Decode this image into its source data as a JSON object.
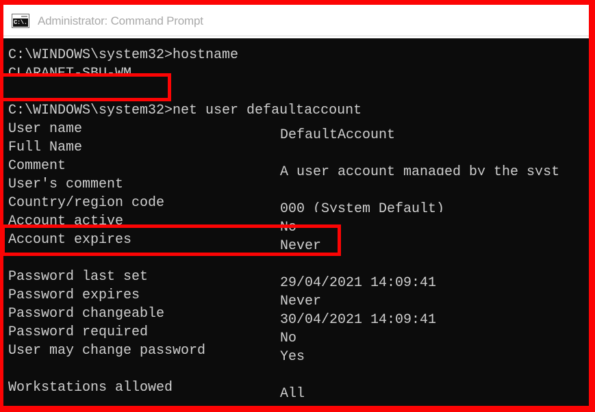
{
  "window": {
    "title": "Administrator: Command Prompt",
    "icon": "command-prompt-icon",
    "icon_glyph": "C:\\.",
    "background_sliver_text": "· ···  ··· ··   ··  ·  ·   ·· ·  ··  ·"
  },
  "colors": {
    "annotation_red": "#fc0404",
    "console_background": "#0c0c0c",
    "console_text": "#cfcfcf",
    "titlebar_background": "#ffffff",
    "titlebar_text": "#a9a9a9"
  },
  "console": {
    "prompt_path": "C:\\WINDOWS\\system32>",
    "lines": [
      {
        "id": "prompt-hostname",
        "type": "prompt",
        "text": "C:\\WINDOWS\\system32>hostname"
      },
      {
        "id": "output-hostname",
        "type": "output",
        "text": "CLARANET-SBU-WM"
      },
      {
        "id": "blank-1",
        "type": "blank",
        "text": ""
      },
      {
        "id": "prompt-net-user",
        "type": "prompt",
        "text": "C:\\WINDOWS\\system32>net user defaultaccount"
      },
      {
        "id": "row-user-name",
        "type": "kv",
        "label": "User name",
        "value": "DefaultAccount"
      },
      {
        "id": "row-full-name",
        "type": "kv",
        "label": "Full Name",
        "value": ""
      },
      {
        "id": "row-comment",
        "type": "kv",
        "label": "Comment",
        "value": "A user account managed by the syst"
      },
      {
        "id": "row-users-comment",
        "type": "kv",
        "label": "User's comment",
        "value": ""
      },
      {
        "id": "row-country-code",
        "type": "kv",
        "label": "Country/region code",
        "value": "000 (System Default)"
      },
      {
        "id": "row-account-active",
        "type": "kv",
        "label": "Account active",
        "value": "No"
      },
      {
        "id": "row-account-expires",
        "type": "kv",
        "label": "Account expires",
        "value": "Never"
      },
      {
        "id": "blank-2",
        "type": "blank",
        "text": ""
      },
      {
        "id": "row-pwd-last-set",
        "type": "kv",
        "label": "Password last set",
        "value": "29/04/2021 14:09:41"
      },
      {
        "id": "row-pwd-expires",
        "type": "kv",
        "label": "Password expires",
        "value": "Never"
      },
      {
        "id": "row-pwd-changeable",
        "type": "kv",
        "label": "Password changeable",
        "value": "30/04/2021 14:09:41"
      },
      {
        "id": "row-pwd-required",
        "type": "kv",
        "label": "Password required",
        "value": "No"
      },
      {
        "id": "row-user-may-change",
        "type": "kv",
        "label": "User may change password",
        "value": "Yes"
      },
      {
        "id": "blank-3",
        "type": "blank",
        "text": ""
      },
      {
        "id": "row-workstations",
        "type": "kv",
        "label": "Workstations allowed",
        "value": "All"
      }
    ]
  },
  "annotations": {
    "hostname_highlight": {
      "target": "CLARANET-SBU-WM",
      "color": "#fc0404"
    },
    "account_active_highlight": {
      "target": "Account active  No",
      "color": "#fc0404"
    },
    "outer_frame": {
      "color": "#fc0404"
    }
  }
}
